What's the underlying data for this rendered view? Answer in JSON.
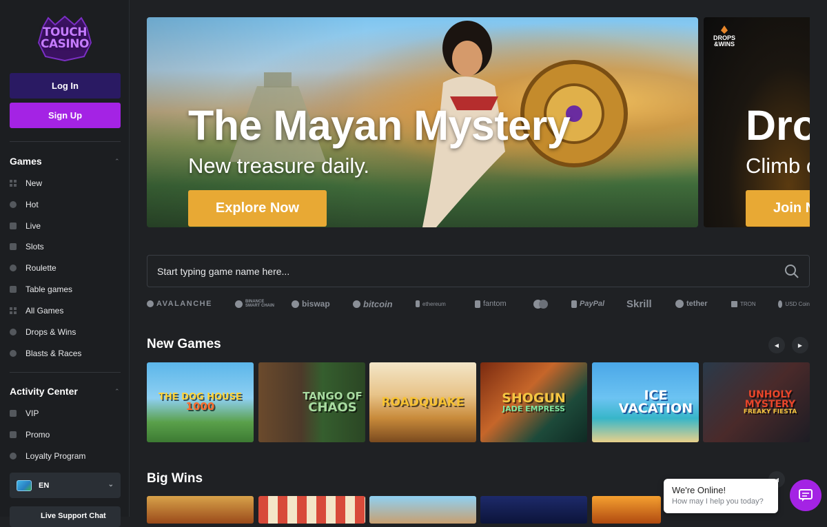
{
  "brand": {
    "logo_text_line1": "TOUCH",
    "logo_text_line2": "CASINO"
  },
  "auth": {
    "login_label": "Log In",
    "signup_label": "Sign Up"
  },
  "sidebar": {
    "games_title": "Games",
    "games_items": [
      {
        "label": "New",
        "icon": "grid-icon"
      },
      {
        "label": "Hot",
        "icon": "fire-icon"
      },
      {
        "label": "Live",
        "icon": "live-icon"
      },
      {
        "label": "Slots",
        "icon": "slots-icon"
      },
      {
        "label": "Roulette",
        "icon": "roulette-icon"
      },
      {
        "label": "Table games",
        "icon": "table-icon"
      },
      {
        "label": "All Games",
        "icon": "grid-icon"
      },
      {
        "label": "Drops & Wins",
        "icon": "trophy-icon"
      },
      {
        "label": "Blasts & Races",
        "icon": "race-icon"
      }
    ],
    "activity_title": "Activity Center",
    "activity_items": [
      {
        "label": "VIP",
        "icon": "crown-icon"
      },
      {
        "label": "Promo",
        "icon": "gift-icon"
      },
      {
        "label": "Loyalty Program",
        "icon": "heart-icon"
      }
    ],
    "language": "EN",
    "live_support": "Live Support Chat"
  },
  "hero": {
    "title": "The Mayan Mystery",
    "subtitle": "New treasure daily.",
    "cta": "Explore Now"
  },
  "hero2": {
    "badge_line1": "DROPS",
    "badge_line2": "&WINS",
    "title": "Drops & Wins",
    "subtitle": "Climb on",
    "cta": "Join Now"
  },
  "search": {
    "placeholder": "Start typing game name here..."
  },
  "payments": [
    "AVALANCHE",
    "BINANCE SMART CHAIN",
    "biswap",
    "bitcoin",
    "ethereum",
    "fantom",
    "Mastercard",
    "PayPal",
    "Skrill",
    "tether",
    "TRON",
    "USD Coin"
  ],
  "new_games": {
    "title": "New Games",
    "tiles": [
      {
        "line1": "THE DOG HOUSE",
        "line2": "1000"
      },
      {
        "line1": "TANGO OF",
        "line2": "CHAOS"
      },
      {
        "line1": "ROADQUAKE",
        "line2": ""
      },
      {
        "line1": "SHOGUN",
        "line2": "JADE EMPRESS"
      },
      {
        "line1": "ICE",
        "line2": "VACATION"
      },
      {
        "line1": "UNHOLY MYSTERY",
        "line2": "FREAKY FIESTA"
      }
    ]
  },
  "big_wins": {
    "title": "Big Wins"
  },
  "chat": {
    "title": "We're Online!",
    "subtitle": "How may I help you today?"
  },
  "colors": {
    "accent": "#a423e4",
    "cta": "#e8a934",
    "bg": "#1f2124",
    "sidebar": "#1c1e21"
  }
}
